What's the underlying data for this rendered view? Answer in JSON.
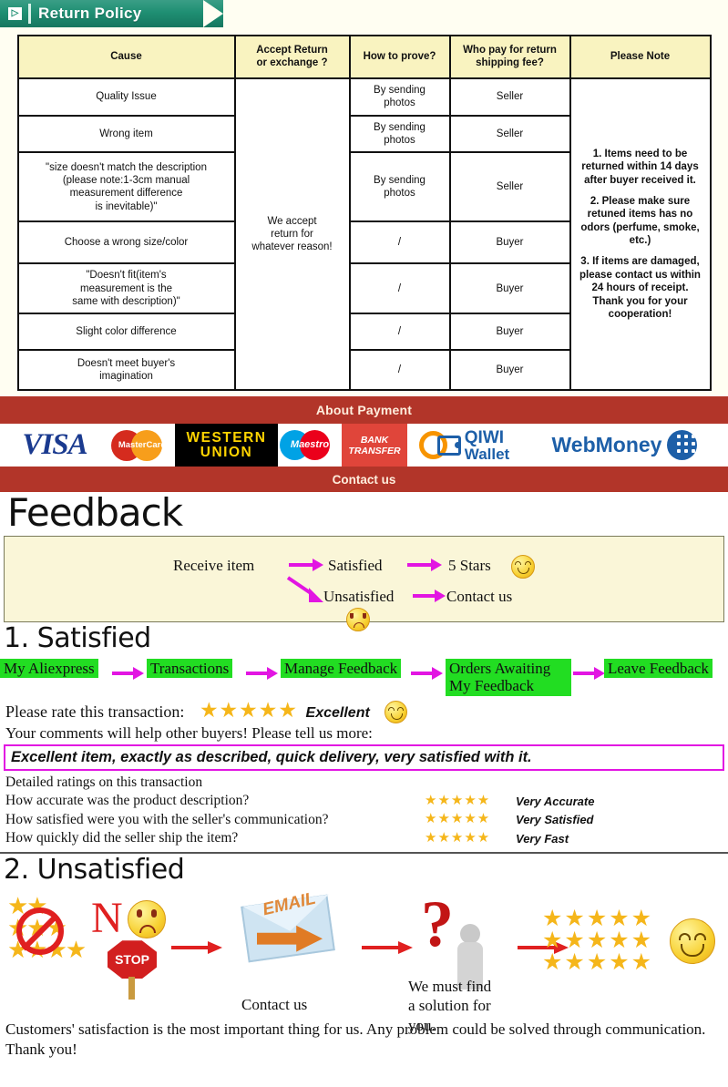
{
  "return_policy": {
    "ribbon_title": "Return Policy",
    "ribbon_icon": "mail-arrow-icon",
    "headers": [
      "Cause",
      "Accept Return\nor exchange ?",
      "How to prove?",
      "Who pay for return\nshipping fee?",
      "Please Note"
    ],
    "accept_cell": "We accept\nreturn for\nwhatever reason!",
    "rows": [
      {
        "cause": "Quality Issue",
        "prove": "By sending\nphotos",
        "who_pays": "Seller"
      },
      {
        "cause": "Wrong item",
        "prove": "By sending\nphotos",
        "who_pays": "Seller"
      },
      {
        "cause": "\"size doesn't match the description\n(please note:1-3cm manual\nmeasurement difference\nis inevitable)\"",
        "prove": "By sending\nphotos",
        "who_pays": "Seller"
      },
      {
        "cause": "Choose a wrong size/color",
        "prove": "/",
        "who_pays": "Buyer"
      },
      {
        "cause": "\"Doesn't fit(item's\nmeasurement is the\nsame with description)\"",
        "prove": "/",
        "who_pays": "Buyer"
      },
      {
        "cause": "Slight color difference",
        "prove": "/",
        "who_pays": "Buyer"
      },
      {
        "cause": "Doesn't meet buyer's\nimagination",
        "prove": "/",
        "who_pays": "Buyer"
      }
    ],
    "notes": [
      "1. Items need to be returned within 14 days after buyer received it.",
      "2. Please make sure retuned items has no odors (perfume, smoke, etc.)",
      "3. If items are damaged, please contact us within 24 hours of receipt.\nThank you for your cooperation!"
    ]
  },
  "payment": {
    "band_title": "About Payment",
    "contact_title": "Contact us",
    "logos": [
      {
        "name": "visa-logo",
        "label": "VISA"
      },
      {
        "name": "mastercard-logo",
        "label": "MasterCard"
      },
      {
        "name": "western-union-logo",
        "line1": "WESTERN",
        "line2": "UNION"
      },
      {
        "name": "maestro-logo",
        "label": "Maestro"
      },
      {
        "name": "bank-transfer-logo",
        "line1": "BANK",
        "line2": "TRANSFER"
      },
      {
        "name": "qiwi-wallet-logo",
        "line1": "QIWI",
        "line2": "Wallet"
      },
      {
        "name": "webmoney-logo",
        "label": "WebMoney"
      }
    ]
  },
  "feedback": {
    "heading": "Feedback",
    "flow": {
      "receive": "Receive item",
      "satisfied": "Satisfied",
      "five_stars": "5 Stars",
      "unsatisfied": "Unsatisfied",
      "contact_us": "Contact us",
      "happy_face": "happy-face-icon",
      "sad_face": "sad-face-icon",
      "arrow_color": "#e215e2"
    }
  },
  "satisfied": {
    "section_title": "1. Satisfied",
    "steps": [
      "My Aliexpress",
      "Transactions",
      "Manage Feedback",
      "Orders Awaiting\nMy Feedback",
      "Leave Feedback"
    ],
    "step_color": "#22dd22",
    "arrow_color": "#e215e2",
    "rate_label": "Please rate this transaction:",
    "rate_stars": "★★★★★",
    "rate_word": "Excellent",
    "comments_prompt": "Your comments will help other buyers! Please tell us more:",
    "comment_text": "Excellent item, exactly as described, quick delivery, very satisfied with it.",
    "comment_border_color": "#e215e2",
    "detail_heading": "Detailed ratings on this transaction",
    "details": [
      {
        "question": "How accurate was the product description?",
        "stars": "★★★★★",
        "value": "Very Accurate"
      },
      {
        "question": "How satisfied were you with the seller's communication?",
        "stars": "★★★★★",
        "value": "Very Satisfied"
      },
      {
        "question": "How quickly did the seller ship the item?",
        "stars": "★★★★★",
        "value": "Very Fast"
      }
    ]
  },
  "unsatisfied": {
    "section_title": "2. Unsatisfied",
    "no_text": "N",
    "stop_text": "STOP",
    "email_text": "EMAIL",
    "contact_caption": "Contact us",
    "solution_caption": "We must find\na solution for\nyou.",
    "arrow_color": "#e02020",
    "icons": [
      "no-rating-icon",
      "sad-face-icon",
      "stop-sign-icon",
      "email-envelope-icon",
      "question-mark-person-icon",
      "stars-grid-icon",
      "happy-face-icon"
    ],
    "footer": "Customers' satisfaction is the most important thing for us. Any problem could be solved through communication. Thank you!"
  }
}
